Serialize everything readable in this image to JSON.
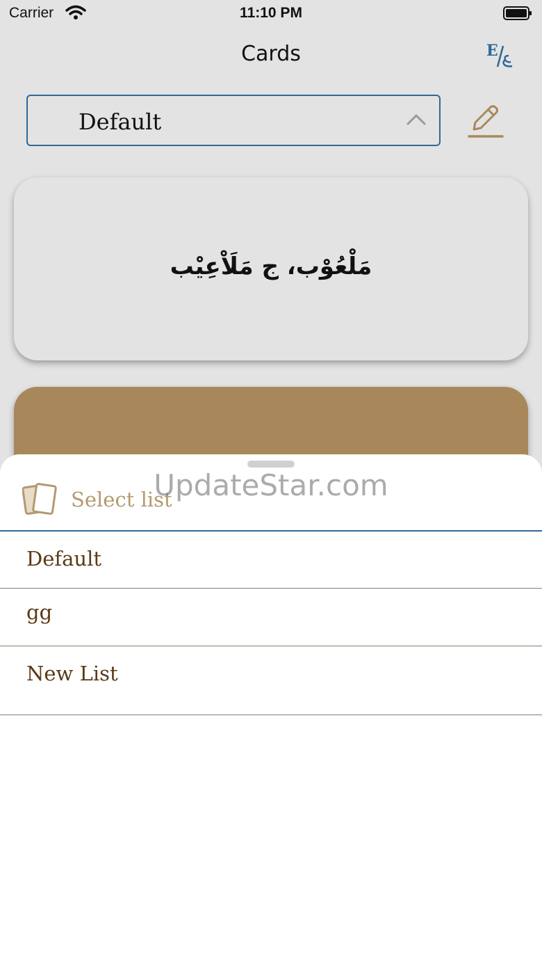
{
  "status_bar": {
    "carrier": "Carrier",
    "time": "11:10 PM"
  },
  "nav": {
    "title": "Cards",
    "language_toggle_icon": "english-arabic-toggle-icon"
  },
  "list_selector": {
    "value": "Default",
    "icon": "chevron-up-icon",
    "edit_icon": "pencil-icon"
  },
  "card": {
    "front_text": "مَلْعُوْب، ج مَلَاْعِيْب"
  },
  "sheet": {
    "title": "Select list",
    "icon": "cards-icon",
    "watermark": "UpdateStar.com",
    "options": [
      {
        "label": "Default"
      },
      {
        "label": "gg"
      },
      {
        "label": "New List"
      }
    ]
  },
  "colors": {
    "accent_blue": "#2f6898",
    "brand_brown": "#a8885a",
    "sheet_title": "#b39a70",
    "option_text": "#5a3a16"
  }
}
